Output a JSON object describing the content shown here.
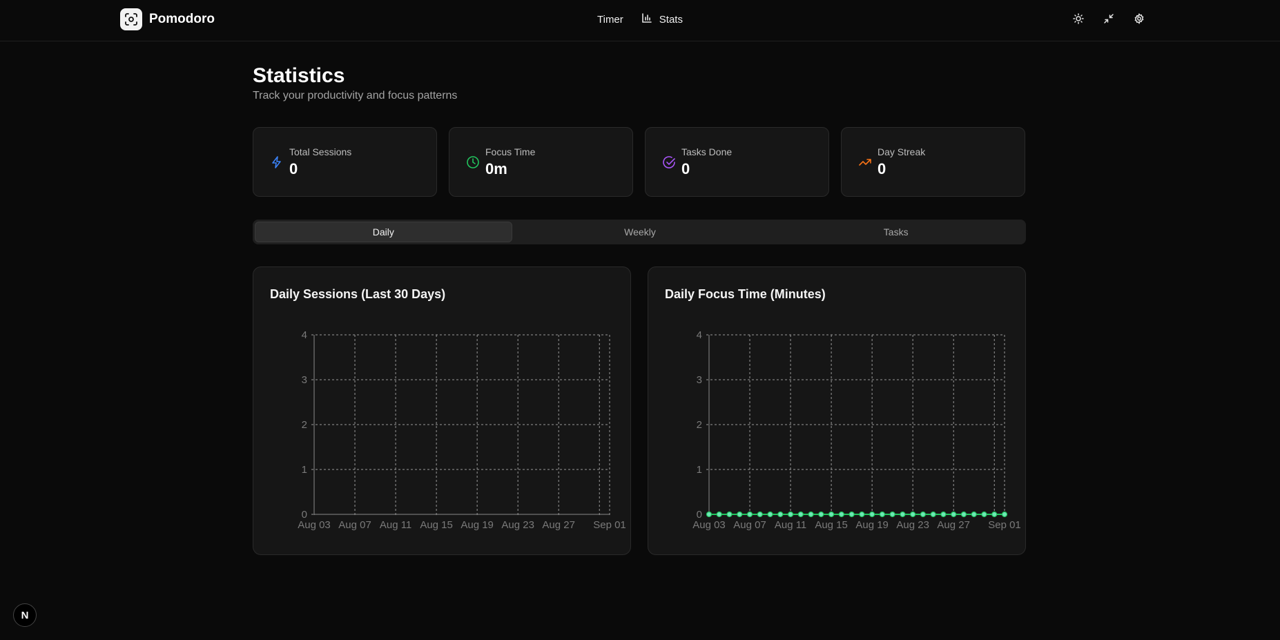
{
  "app": {
    "name": "Pomodoro"
  },
  "nav": {
    "timer": "Timer",
    "stats": "Stats"
  },
  "tools": {
    "theme": "sun-icon",
    "collapse": "minimize-icon",
    "settings": "gear-icon"
  },
  "page": {
    "title": "Statistics",
    "subtitle": "Track your productivity and focus patterns"
  },
  "stats": [
    {
      "label": "Total Sessions",
      "value": "0",
      "icon": "lightning-icon",
      "color": "#3b82f6"
    },
    {
      "label": "Focus Time",
      "value": "0m",
      "icon": "clock-icon",
      "color": "#22c55e"
    },
    {
      "label": "Tasks Done",
      "value": "0",
      "icon": "check-circle-icon",
      "color": "#a855f7"
    },
    {
      "label": "Day Streak",
      "value": "0",
      "icon": "trending-up-icon",
      "color": "#f97316"
    }
  ],
  "tabs": [
    {
      "label": "Daily",
      "active": true
    },
    {
      "label": "Weekly",
      "active": false
    },
    {
      "label": "Tasks",
      "active": false
    }
  ],
  "colors": {
    "line": "#22c55e",
    "dot": "#6ee7b7"
  },
  "chart_data": [
    {
      "type": "bar",
      "title": "Daily Sessions (Last 30 Days)",
      "xlabel": "",
      "ylabel": "",
      "ylim": [
        0,
        4
      ],
      "yticks": [
        0,
        1,
        2,
        3,
        4
      ],
      "x_tick_labels": [
        "Aug 03",
        "Aug 07",
        "Aug 11",
        "Aug 15",
        "Aug 19",
        "Aug 23",
        "Aug 27",
        "Sep 01"
      ],
      "x": [
        "Aug 03",
        "Aug 04",
        "Aug 05",
        "Aug 06",
        "Aug 07",
        "Aug 08",
        "Aug 09",
        "Aug 10",
        "Aug 11",
        "Aug 12",
        "Aug 13",
        "Aug 14",
        "Aug 15",
        "Aug 16",
        "Aug 17",
        "Aug 18",
        "Aug 19",
        "Aug 20",
        "Aug 21",
        "Aug 22",
        "Aug 23",
        "Aug 24",
        "Aug 25",
        "Aug 26",
        "Aug 27",
        "Aug 28",
        "Aug 29",
        "Aug 30",
        "Aug 31",
        "Sep 01"
      ],
      "values": [
        0,
        0,
        0,
        0,
        0,
        0,
        0,
        0,
        0,
        0,
        0,
        0,
        0,
        0,
        0,
        0,
        0,
        0,
        0,
        0,
        0,
        0,
        0,
        0,
        0,
        0,
        0,
        0,
        0,
        0
      ],
      "grid": true
    },
    {
      "type": "line",
      "title": "Daily Focus Time (Minutes)",
      "xlabel": "",
      "ylabel": "",
      "ylim": [
        0,
        4
      ],
      "yticks": [
        0,
        1,
        2,
        3,
        4
      ],
      "x_tick_labels": [
        "Aug 03",
        "Aug 07",
        "Aug 11",
        "Aug 15",
        "Aug 19",
        "Aug 23",
        "Aug 27",
        "Sep 01"
      ],
      "x": [
        "Aug 03",
        "Aug 04",
        "Aug 05",
        "Aug 06",
        "Aug 07",
        "Aug 08",
        "Aug 09",
        "Aug 10",
        "Aug 11",
        "Aug 12",
        "Aug 13",
        "Aug 14",
        "Aug 15",
        "Aug 16",
        "Aug 17",
        "Aug 18",
        "Aug 19",
        "Aug 20",
        "Aug 21",
        "Aug 22",
        "Aug 23",
        "Aug 24",
        "Aug 25",
        "Aug 26",
        "Aug 27",
        "Aug 28",
        "Aug 29",
        "Aug 30",
        "Aug 31",
        "Sep 01"
      ],
      "values": [
        0,
        0,
        0,
        0,
        0,
        0,
        0,
        0,
        0,
        0,
        0,
        0,
        0,
        0,
        0,
        0,
        0,
        0,
        0,
        0,
        0,
        0,
        0,
        0,
        0,
        0,
        0,
        0,
        0,
        0
      ],
      "grid": true
    }
  ],
  "badge": {
    "label": "N"
  }
}
